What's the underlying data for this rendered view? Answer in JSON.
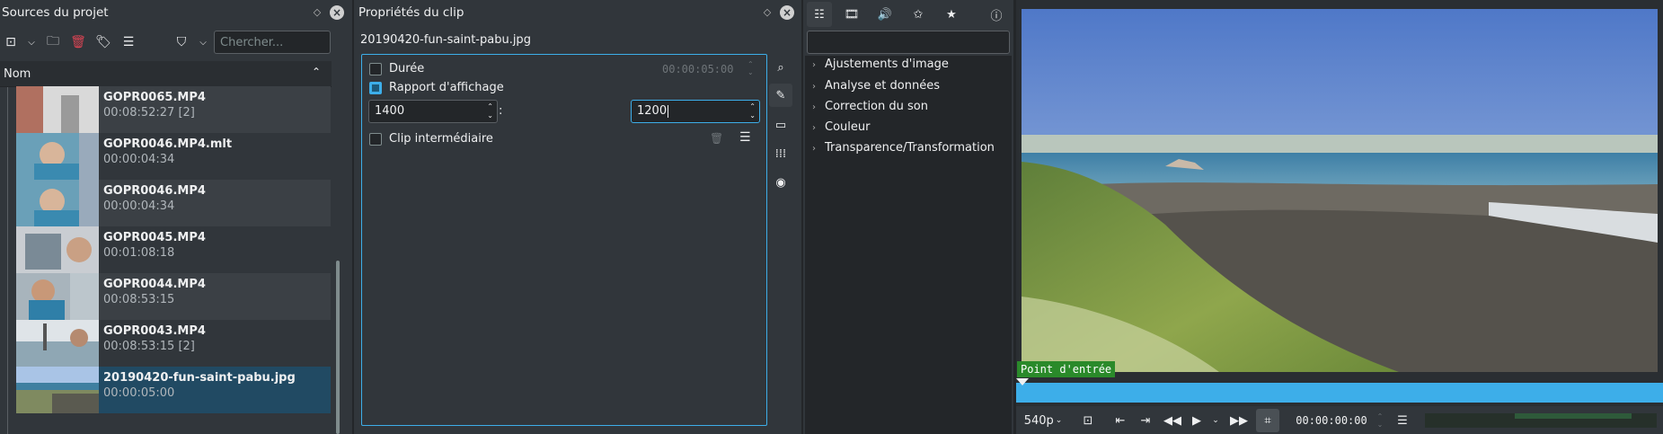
{
  "project_bin": {
    "title": "Sources du projet",
    "search_placeholder": "Chercher...",
    "column_name": "Nom",
    "clips": [
      {
        "name": "GOPR0065.MP4",
        "duration": "00:08:52:27 [2]"
      },
      {
        "name": "GOPR0046.MP4.mlt",
        "duration": "00:00:04:34"
      },
      {
        "name": "GOPR0046.MP4",
        "duration": "00:00:04:34"
      },
      {
        "name": "GOPR0045.MP4",
        "duration": "00:01:08:18"
      },
      {
        "name": "GOPR0044.MP4",
        "duration": "00:08:53:15"
      },
      {
        "name": "GOPR0043.MP4",
        "duration": "00:08:53:15 [2]"
      },
      {
        "name": "20190420-fun-saint-pabu.jpg",
        "duration": "00:00:05:00"
      }
    ]
  },
  "clip_properties": {
    "title": "Propriétés du clip",
    "filename": "20190420-fun-saint-pabu.jpg",
    "duration_label": "Durée",
    "duration_value": "00:00:05:00",
    "aspect_label": "Rapport d'affichage",
    "aspect_width": "1400",
    "aspect_separator": ":",
    "aspect_height": "1200",
    "proxy_label": "Clip intermédiaire"
  },
  "effects": {
    "categories": [
      "Ajustements d'image",
      "Analyse et données",
      "Correction du son",
      "Couleur",
      "Transparence/Transformation"
    ]
  },
  "monitor": {
    "in_point_label": "Point d'entrée",
    "zoom": "540p",
    "timecode": "00:00:00:00"
  },
  "colors": {
    "accent": "#3daee9",
    "selection": "#214a63",
    "in_point": "#2a8a2a"
  }
}
